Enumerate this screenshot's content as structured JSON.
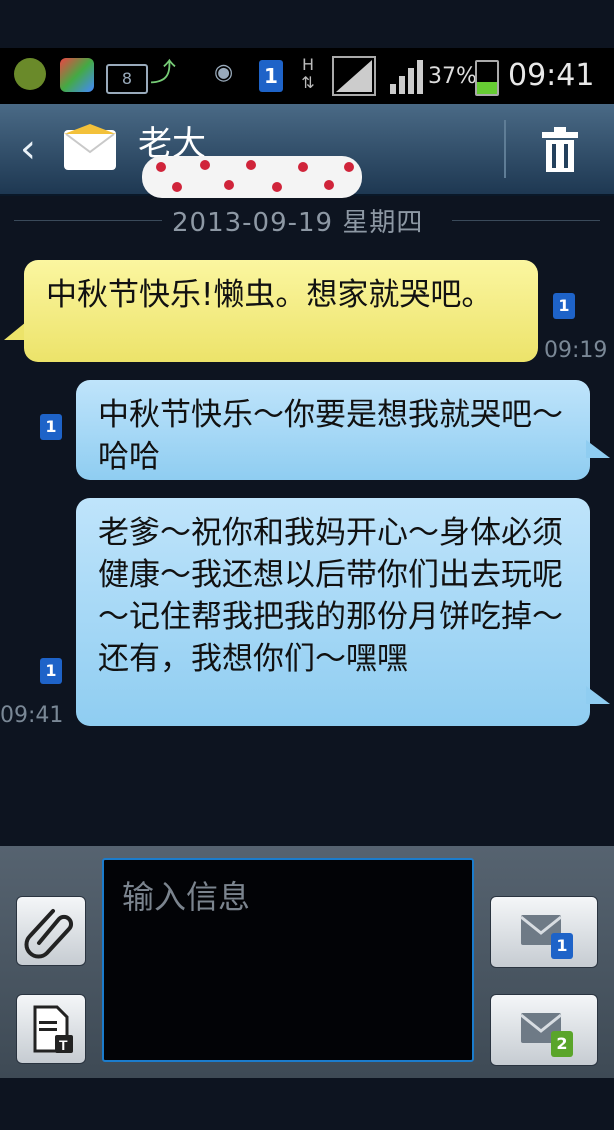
{
  "status_bar": {
    "battery_percent": "37%",
    "battery_level": 0.37,
    "time": "09:41",
    "sim_badge": "1",
    "network_label": "H",
    "sd_label": "8"
  },
  "header": {
    "contact_name": "老大"
  },
  "thread": {
    "date_separator": "2013-09-19 星期四",
    "messages": [
      {
        "direction": "incoming",
        "text": "中秋节快乐!懒虫。想家就哭吧。",
        "time": "09:19",
        "sim": "1"
      },
      {
        "direction": "outgoing",
        "text": "中秋节快乐～你要是想我就哭吧～哈哈",
        "time": "",
        "sim": "1"
      },
      {
        "direction": "outgoing",
        "text": "老爹～祝你和我妈开心～身体必须健康～我还想以后带你们出去玩呢～记住帮我把我的那份月饼吃掉～还有，我想你们～嘿嘿",
        "time": "09:41",
        "sim": "1"
      }
    ]
  },
  "compose": {
    "placeholder": "输入信息",
    "send_sim1_badge": "1",
    "send_sim2_badge": "2"
  },
  "colors": {
    "incoming_bubble": "#ece36a",
    "outgoing_bubble": "#8fcdf1",
    "sim1": "#1e63c8",
    "sim2": "#5aa52a",
    "header": "#2c4a66"
  },
  "icons": {
    "back": "chevron-left-icon",
    "contact": "envelope-icon",
    "delete": "trash-icon",
    "attach": "paperclip-icon",
    "template": "text-template-icon",
    "send1": "send-sim1-icon",
    "send2": "send-sim2-icon"
  }
}
